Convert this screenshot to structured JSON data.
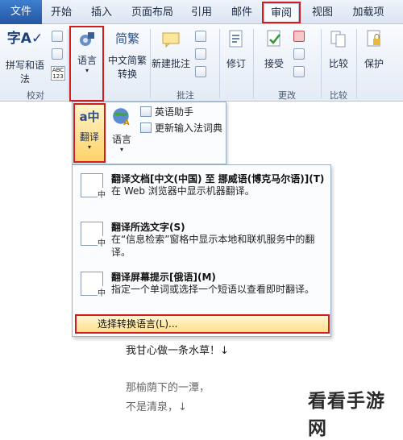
{
  "tabs": [
    {
      "label": "文件"
    },
    {
      "label": "开始"
    },
    {
      "label": "插入"
    },
    {
      "label": "页面布局"
    },
    {
      "label": "引用"
    },
    {
      "label": "邮件"
    },
    {
      "label": "审阅"
    },
    {
      "label": "视图"
    },
    {
      "label": "加载项"
    }
  ],
  "ribbon": {
    "spelling_label": "拼写和语法",
    "abc_label": "ABC\n123",
    "language_label": "语言",
    "zh_convert_label1": "中文简繁",
    "zh_convert_label2": "转换",
    "new_comment_label": "新建批注",
    "track_label": "修订",
    "accept_label": "接受",
    "compare_label": "比较",
    "protect_label": "保护",
    "groups": {
      "proofing": "校对",
      "comments": "批注",
      "changes": "更改",
      "compare": "比较"
    }
  },
  "language_panel": {
    "translate_label": "翻译",
    "language_label": "语言",
    "english_assistant": "英语助手",
    "update_ime_dict": "更新输入法词典"
  },
  "translate_menu": {
    "items": [
      {
        "title": "翻译文档[中文(中国) 至 挪威语(博克马尔语)](T)",
        "desc": "在 Web 浏览器中显示机器翻译。"
      },
      {
        "title": "翻译所选文字(S)",
        "desc": "在“信息检索”窗格中显示本地和联机服务中的翻译。"
      },
      {
        "title": "翻译屏幕提示[俄语](M)",
        "desc": "指定一个单词或选择一个短语以查看即时翻译。"
      }
    ],
    "choose_language": "选择转换语言(L)..."
  },
  "document": {
    "lines": [
      "我甘心做一条水草！↓",
      "那榆荫下的一潭，",
      "不是清泉，↓"
    ]
  },
  "watermark": "看看手游网"
}
